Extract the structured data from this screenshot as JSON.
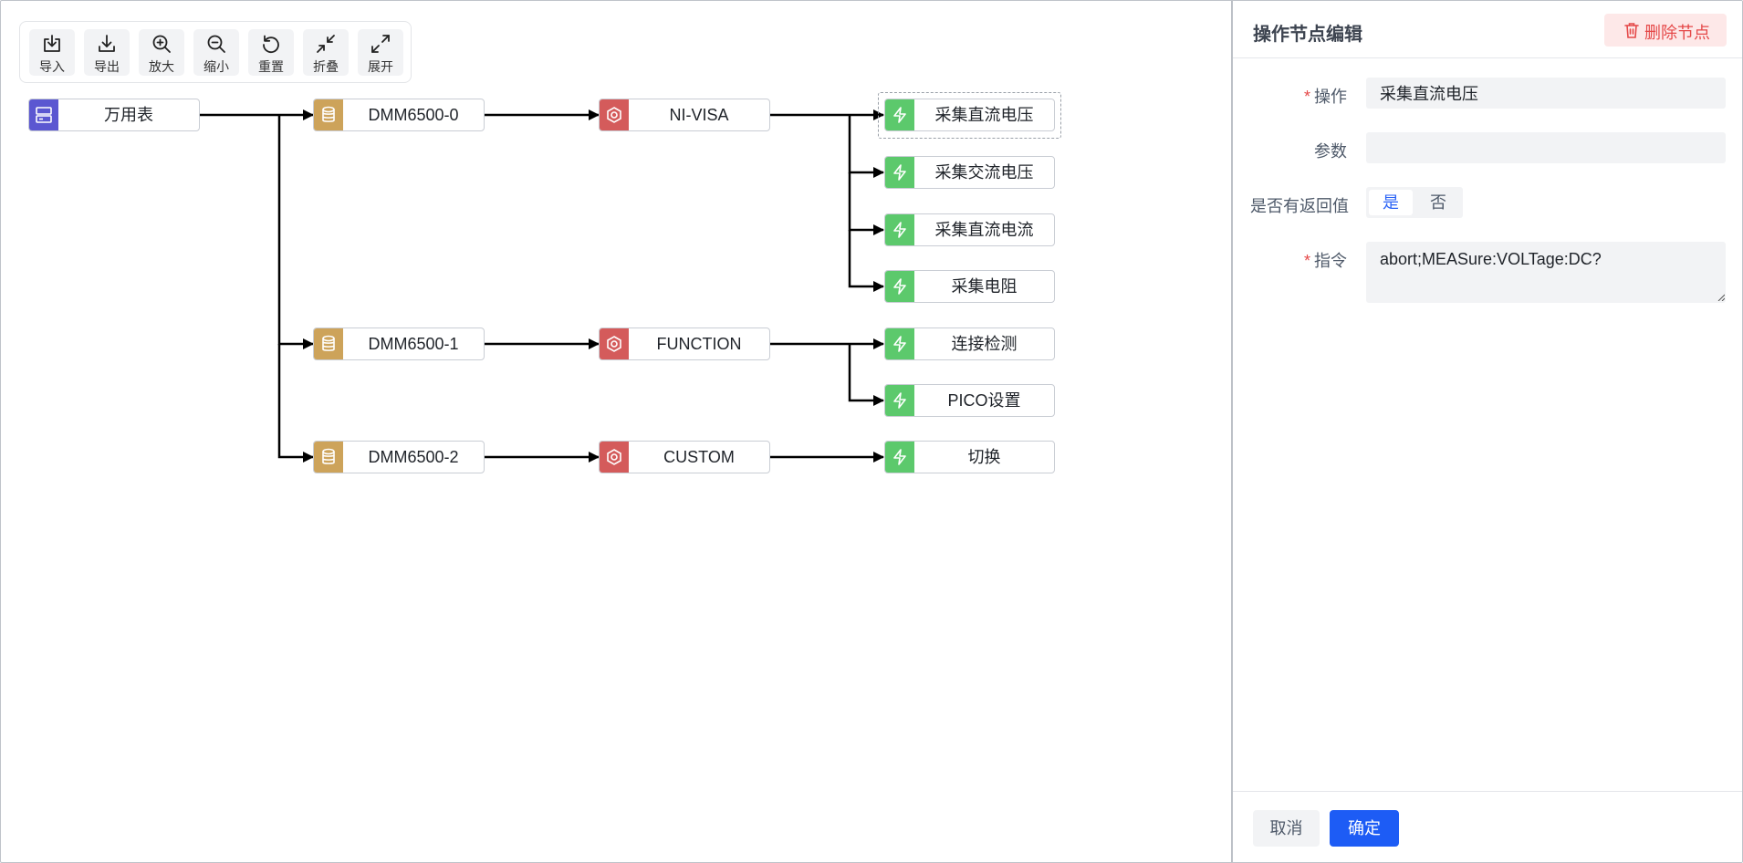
{
  "toolbar": {
    "buttons": [
      {
        "label": "导入",
        "icon": "import-icon"
      },
      {
        "label": "导出",
        "icon": "export-icon"
      },
      {
        "label": "放大",
        "icon": "zoom-in-icon"
      },
      {
        "label": "缩小",
        "icon": "zoom-out-icon"
      },
      {
        "label": "重置",
        "icon": "reset-icon"
      },
      {
        "label": "折叠",
        "icon": "collapse-icon"
      },
      {
        "label": "展开",
        "icon": "expand-icon"
      }
    ]
  },
  "flow": {
    "root": {
      "label": "万用表",
      "type": "device-type",
      "icon": "server-icon"
    },
    "devices": [
      {
        "label": "DMM6500-0",
        "icon": "database-icon"
      },
      {
        "label": "DMM6500-1",
        "icon": "database-icon"
      },
      {
        "label": "DMM6500-2",
        "icon": "database-icon"
      }
    ],
    "protocols": [
      {
        "label": "NI-VISA",
        "icon": "hexagon-gear-icon"
      },
      {
        "label": "FUNCTION",
        "icon": "hexagon-gear-icon"
      },
      {
        "label": "CUSTOM",
        "icon": "hexagon-gear-icon"
      }
    ],
    "operations": [
      {
        "label": "采集直流电压",
        "icon": "lightning-icon",
        "selected": true
      },
      {
        "label": "采集交流电压",
        "icon": "lightning-icon"
      },
      {
        "label": "采集直流电流",
        "icon": "lightning-icon"
      },
      {
        "label": "采集电阻",
        "icon": "lightning-icon"
      },
      {
        "label": "连接检测",
        "icon": "lightning-icon"
      },
      {
        "label": "PICO设置",
        "icon": "lightning-icon"
      },
      {
        "label": "切换",
        "icon": "lightning-icon"
      }
    ],
    "colors": {
      "root": "#5b57d1",
      "device": "#cda35a",
      "protocol": "#d45b5b",
      "operation": "#5cc96c",
      "edge": "#000000"
    }
  },
  "panel": {
    "title": "操作节点编辑",
    "delete_label": "删除节点",
    "fields": {
      "operation": {
        "label": "操作",
        "value": "采集直流电压",
        "required": true
      },
      "params": {
        "label": "参数",
        "value": "",
        "required": false
      },
      "has_return": {
        "label": "是否有返回值",
        "options": [
          "是",
          "否"
        ],
        "selected": "是"
      },
      "command": {
        "label": "指令",
        "value": "abort;MEASure:VOLTage:DC?",
        "required": true
      }
    },
    "cancel_label": "取消",
    "confirm_label": "确定"
  }
}
